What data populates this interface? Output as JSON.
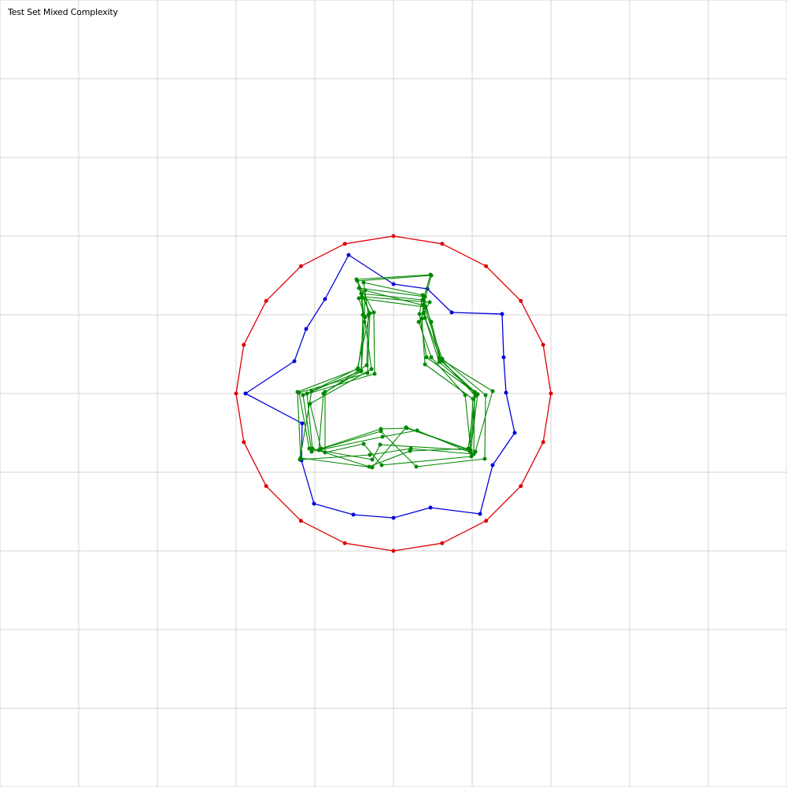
{
  "title": "Test Set Mixed Complexity",
  "colors": {
    "background": "#ffffff",
    "grid": "#d3d3d3",
    "red": "#e00000",
    "blue": "#0000dd",
    "green": "#008800"
  },
  "chart_data": {
    "type": "polygon-set",
    "x_range": [
      -5,
      5
    ],
    "y_range": [
      -5,
      5
    ],
    "grid_step": 1,
    "polygons": [
      {
        "color_key": "red",
        "closed": true,
        "points": [
          [
            0,
            2
          ],
          [
            0.618,
            1.902
          ],
          [
            1.176,
            1.618
          ],
          [
            1.618,
            1.176
          ],
          [
            1.902,
            0.618
          ],
          [
            2,
            0
          ],
          [
            1.902,
            -0.618
          ],
          [
            1.618,
            -1.176
          ],
          [
            1.176,
            -1.618
          ],
          [
            0.618,
            -1.902
          ],
          [
            0,
            -2
          ],
          [
            -0.618,
            -1.902
          ],
          [
            -1.176,
            -1.618
          ],
          [
            -1.618,
            -1.176
          ],
          [
            -1.902,
            -0.618
          ],
          [
            -2,
            0
          ],
          [
            -1.902,
            0.618
          ],
          [
            -1.618,
            1.176
          ],
          [
            -1.176,
            1.618
          ],
          [
            -0.618,
            1.902
          ]
        ]
      },
      {
        "color_key": "blue",
        "closed": true,
        "points": [
          [
            0,
            1.39
          ],
          [
            0.43,
            1.33
          ],
          [
            0.74,
            1.03
          ],
          [
            1.38,
            1.01
          ],
          [
            1.4,
            0.46
          ],
          [
            1.43,
            0.01
          ],
          [
            1.54,
            -0.5
          ],
          [
            1.26,
            -0.91
          ],
          [
            1.1,
            -1.53
          ],
          [
            0.47,
            -1.45
          ],
          [
            0,
            -1.58
          ],
          [
            -0.51,
            -1.54
          ],
          [
            -1.01,
            -1.4
          ],
          [
            -1.17,
            -0.85
          ],
          [
            -1.16,
            -0.38
          ],
          [
            -1.88,
            0
          ],
          [
            -1.26,
            0.41
          ],
          [
            -1.11,
            0.82
          ],
          [
            -0.87,
            1.2
          ],
          [
            -0.57,
            1.76
          ]
        ]
      },
      {
        "color_key": "green",
        "closed": true,
        "points": [
          [
            -0.47,
            1.45
          ],
          [
            0.47,
            1.51
          ],
          [
            0.39,
            1.23
          ],
          [
            0.58,
            0.45
          ],
          [
            1.26,
            0.03
          ],
          [
            1.04,
            -0.74
          ],
          [
            0.16,
            -0.43
          ],
          [
            -0.27,
            -0.94
          ],
          [
            -1.18,
            -0.82
          ],
          [
            -1.22,
            0.02
          ],
          [
            -0.46,
            0.31
          ],
          [
            -0.3,
            1.02
          ]
        ]
      },
      {
        "color_key": "green",
        "closed": true,
        "points": [
          [
            -0.44,
            1.34
          ],
          [
            0.4,
            1.23
          ],
          [
            0.38,
            1.02
          ],
          [
            0.61,
            0.41
          ],
          [
            1.07,
            -0.01
          ],
          [
            0.98,
            -0.72
          ],
          [
            -0.17,
            -0.65
          ],
          [
            -0.27,
            -0.84
          ],
          [
            -1.07,
            -0.7
          ],
          [
            -1.2,
            0.01
          ],
          [
            -0.33,
            0.26
          ],
          [
            -0.3,
            1.02
          ]
        ]
      },
      {
        "color_key": "green",
        "closed": true,
        "points": [
          [
            -0.46,
            1.43
          ],
          [
            0.48,
            1.5
          ],
          [
            0.38,
            1.13
          ],
          [
            0.62,
            0.44
          ],
          [
            1.17,
            -0.02
          ],
          [
            1.16,
            -0.83
          ],
          [
            0.29,
            -0.93
          ],
          [
            -0.16,
            -0.48
          ],
          [
            -1.04,
            -0.74
          ],
          [
            -1.15,
            -0.02
          ],
          [
            -0.24,
            0.25
          ],
          [
            -0.25,
            1.03
          ]
        ]
      },
      {
        "color_key": "green",
        "closed": true,
        "points": [
          [
            -0.44,
            1.21
          ],
          [
            0.4,
            1.1
          ],
          [
            0.4,
            0.96
          ],
          [
            0.58,
            0.4
          ],
          [
            1.03,
            0.02
          ],
          [
            1.02,
            -0.77
          ],
          [
            0.22,
            -0.7
          ],
          [
            -0.3,
            -0.78
          ],
          [
            -1.19,
            -0.84
          ],
          [
            -1.04,
            0.03
          ],
          [
            -0.45,
            0.32
          ],
          [
            -0.36,
            0.97
          ]
        ]
      },
      {
        "color_key": "green",
        "closed": true,
        "points": [
          [
            -0.41,
            1.27
          ],
          [
            0.37,
            1.19
          ],
          [
            0.48,
            0.91
          ],
          [
            0.6,
            0.44
          ],
          [
            1.04,
            -0.03
          ],
          [
            0.95,
            -0.7
          ],
          [
            0.21,
            -0.73
          ],
          [
            -0.31,
            -0.93
          ],
          [
            -1.03,
            -0.7
          ],
          [
            -1.1,
            0.0
          ],
          [
            -0.41,
            0.29
          ],
          [
            -0.39,
            1.0
          ]
        ]
      },
      {
        "color_key": "green",
        "closed": true,
        "points": [
          [
            -0.38,
            1.41
          ],
          [
            0.37,
            1.25
          ],
          [
            0.33,
            1.01
          ],
          [
            0.42,
            0.46
          ],
          [
            1.04,
            0.01
          ],
          [
            0.98,
            -0.75
          ],
          [
            0.3,
            -0.47
          ],
          [
            -0.14,
            -0.55
          ],
          [
            -0.95,
            -0.72
          ],
          [
            -0.89,
            0.0
          ],
          [
            -0.34,
            0.36
          ],
          [
            -0.32,
            1.0
          ]
        ]
      },
      {
        "color_key": "green",
        "closed": true,
        "points": [
          [
            -0.36,
            1.31
          ],
          [
            0.38,
            1.12
          ],
          [
            0.36,
            0.95
          ],
          [
            0.4,
            0.37
          ],
          [
            1.01,
            -0.07
          ],
          [
            0.97,
            -0.72
          ],
          [
            0.17,
            -0.44
          ],
          [
            -0.16,
            -0.45
          ],
          [
            -0.92,
            -0.7
          ],
          [
            -1.06,
            -0.13
          ],
          [
            -0.28,
            0.31
          ],
          [
            -0.37,
            0.98
          ]
        ]
      },
      {
        "color_key": "green",
        "closed": true,
        "points": [
          [
            -0.4,
            1.23
          ],
          [
            0.46,
            1.16
          ],
          [
            0.32,
            0.91
          ],
          [
            0.48,
            0.46
          ],
          [
            0.91,
            -0.02
          ],
          [
            0.99,
            -0.8
          ],
          [
            -0.15,
            -0.91
          ],
          [
            -0.38,
            -0.64
          ],
          [
            -0.87,
            -0.75
          ],
          [
            -0.87,
            0.02
          ],
          [
            -0.41,
            0.28
          ],
          [
            -0.37,
            0.91
          ]
        ]
      }
    ]
  }
}
